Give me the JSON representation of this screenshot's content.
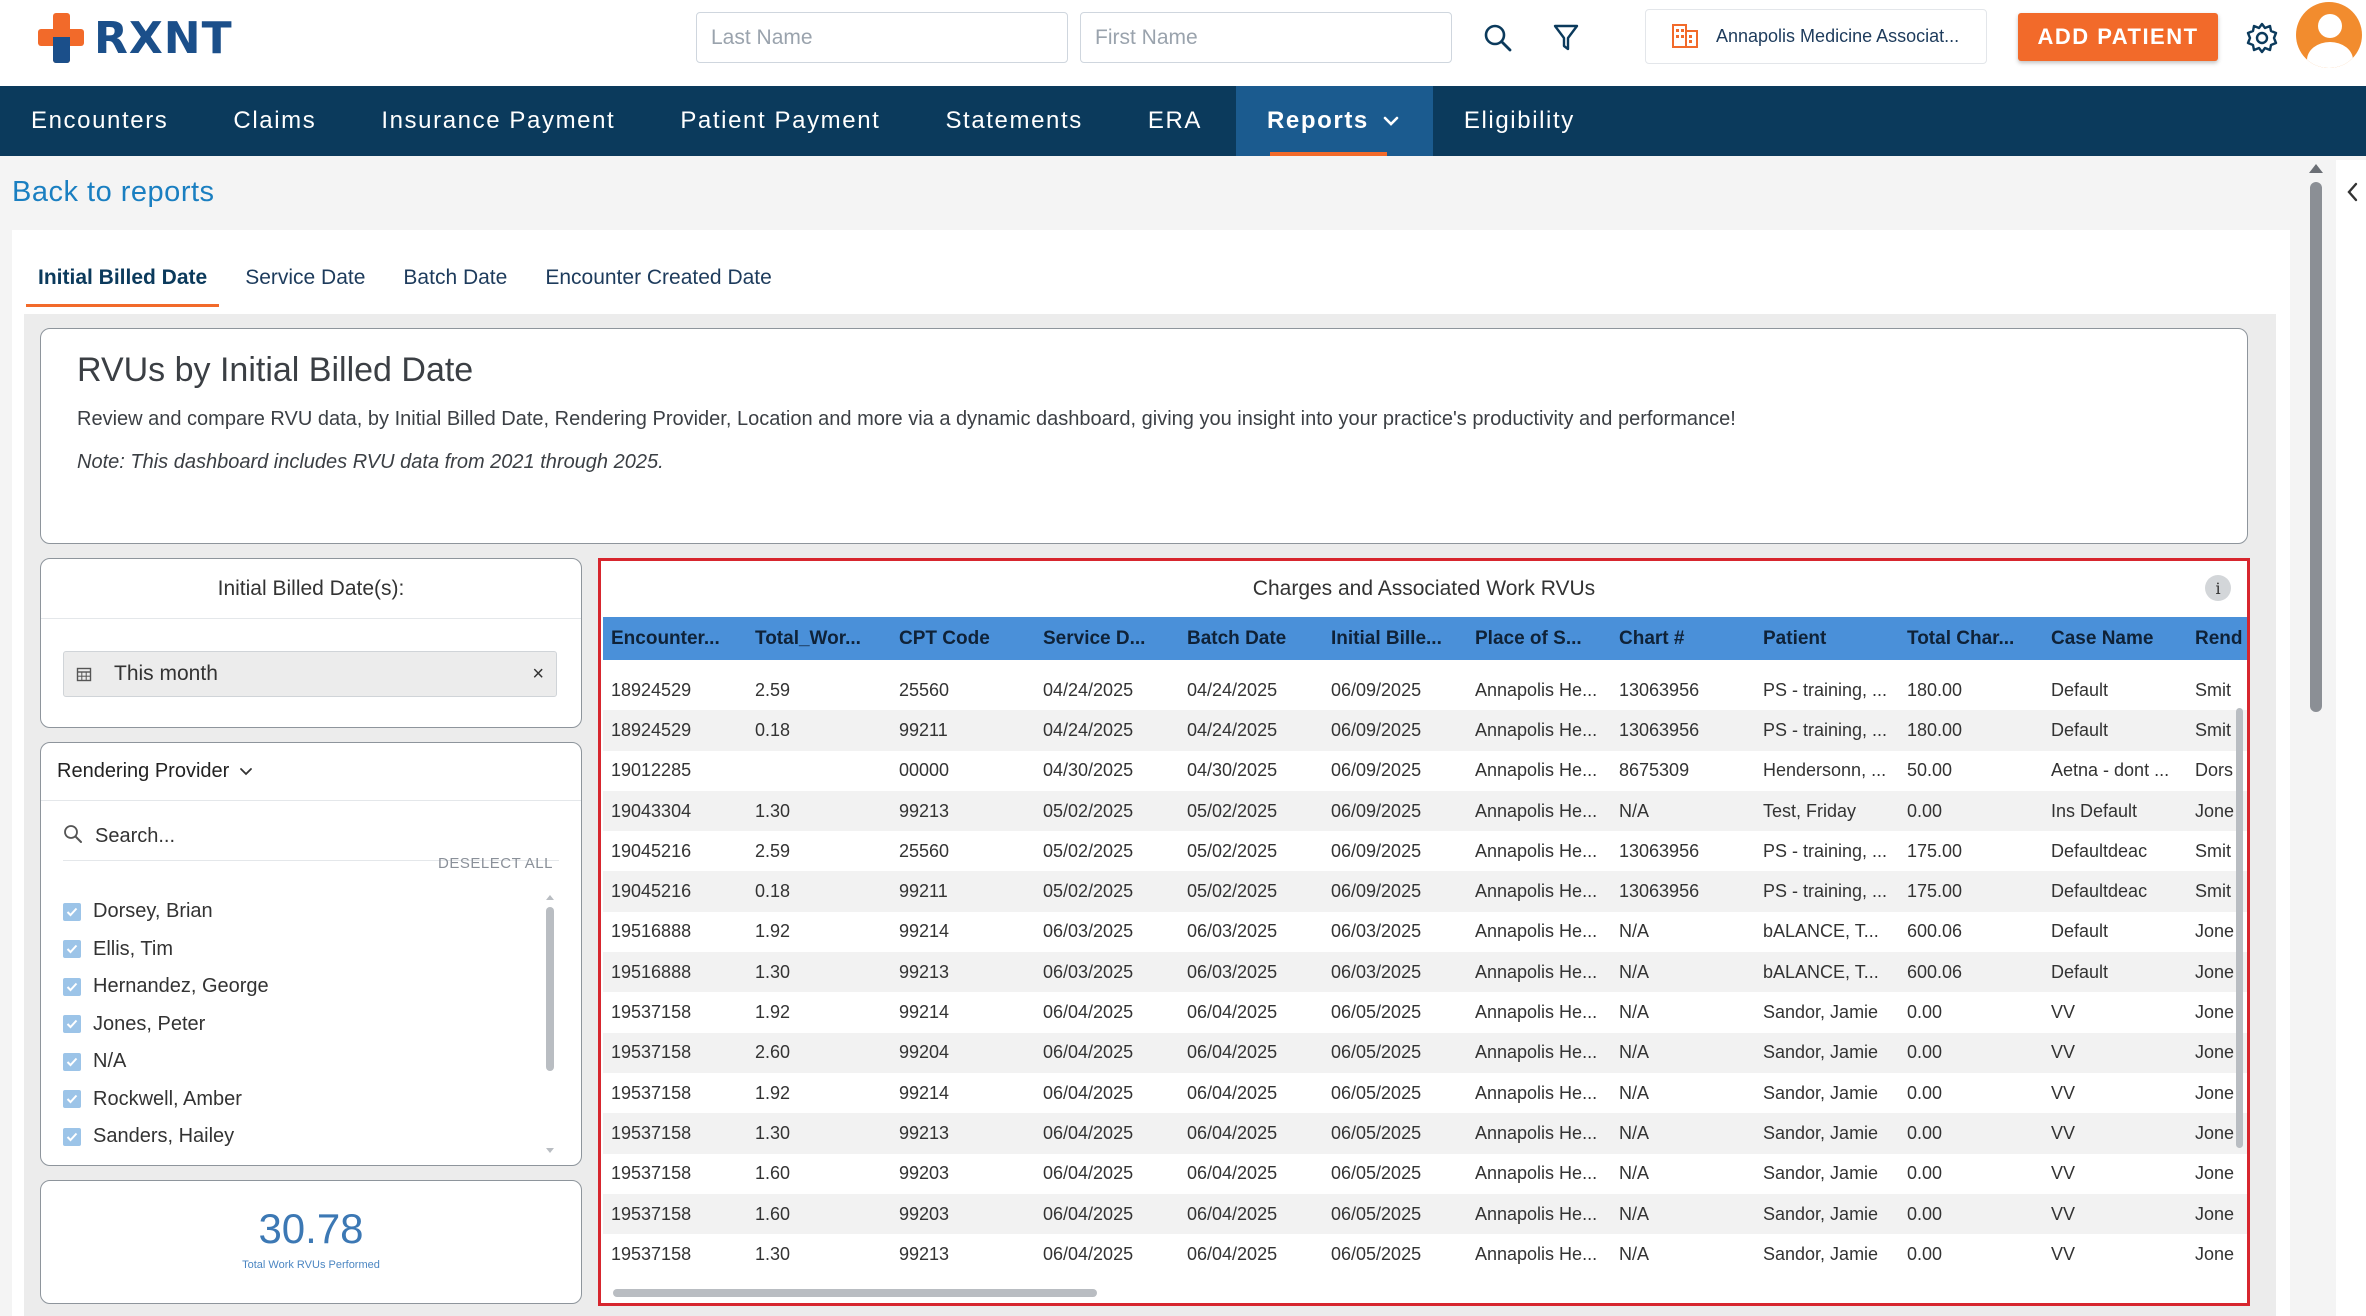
{
  "header": {
    "logo_text": "RXNT",
    "last_name_placeholder": "Last Name",
    "first_name_placeholder": "First Name",
    "icons": [
      "search-icon",
      "filter-icon",
      "building-icon",
      "gear-icon"
    ],
    "practice_name": "Annapolis Medicine Associat...",
    "add_patient_label": "ADD PATIENT",
    "colors": {
      "brand_orange": "#f26a2a",
      "brand_blue": "#1b4f8a",
      "nav_bg": "#0b3a5c"
    }
  },
  "nav": {
    "items": [
      "Encounters",
      "Claims",
      "Insurance Payment",
      "Patient Payment",
      "Statements",
      "ERA",
      "Reports",
      "Eligibility"
    ],
    "active": "Reports"
  },
  "page": {
    "back_link": "Back to reports",
    "tabs": [
      "Initial Billed Date",
      "Service Date",
      "Batch Date",
      "Encounter Created Date"
    ],
    "active_tab": "Initial Billed Date"
  },
  "info": {
    "title": "RVUs by Initial Billed Date",
    "description": "Review and compare RVU data, by Initial Billed Date, Rendering Provider, Location and more via a dynamic dashboard, giving you insight into your practice's productivity and performance!",
    "note": "Note: This dashboard includes RVU data from 2021 through 2025."
  },
  "filters": {
    "date_title": "Initial Billed Date(s):",
    "date_value": "This month",
    "clear_symbol": "×",
    "provider_title": "Rendering Provider",
    "provider_search_placeholder": "Search...",
    "deselect_all": "DESELECT ALL",
    "providers": [
      "Dorsey, Brian",
      "Ellis, Tim",
      "Hernandez, George",
      "Jones, Peter",
      "N/A",
      "Rockwell, Amber",
      "Sanders, Hailey"
    ]
  },
  "kpi": {
    "value": "30.78",
    "label": "Total Work RVUs Performed"
  },
  "table": {
    "title": "Charges and Associated Work RVUs",
    "info_symbol": "i",
    "columns": [
      "Encounter...",
      "Total_Wor...",
      "CPT Code",
      "Service D...",
      "Batch Date",
      "Initial Bille...",
      "Place of S...",
      "Chart #",
      "Patient",
      "Total Char...",
      "Case Name",
      "Rend"
    ],
    "rows": [
      [
        "18924529",
        "2.59",
        "25560",
        "04/24/2025",
        "04/24/2025",
        "06/09/2025",
        "Annapolis He...",
        "13063956",
        "PS - training, ...",
        "180.00",
        "Default",
        "Smit"
      ],
      [
        "18924529",
        "0.18",
        "99211",
        "04/24/2025",
        "04/24/2025",
        "06/09/2025",
        "Annapolis He...",
        "13063956",
        "PS - training, ...",
        "180.00",
        "Default",
        "Smit"
      ],
      [
        "19012285",
        "",
        "00000",
        "04/30/2025",
        "04/30/2025",
        "06/09/2025",
        "Annapolis He...",
        "8675309",
        "Hendersonn, ...",
        "50.00",
        "Aetna - dont ...",
        "Dors"
      ],
      [
        "19043304",
        "1.30",
        "99213",
        "05/02/2025",
        "05/02/2025",
        "06/09/2025",
        "Annapolis He...",
        "N/A",
        "Test, Friday",
        "0.00",
        "Ins Default",
        "Jone"
      ],
      [
        "19045216",
        "2.59",
        "25560",
        "05/02/2025",
        "05/02/2025",
        "06/09/2025",
        "Annapolis He...",
        "13063956",
        "PS - training, ...",
        "175.00",
        "Defaultdeac",
        "Smit"
      ],
      [
        "19045216",
        "0.18",
        "99211",
        "05/02/2025",
        "05/02/2025",
        "06/09/2025",
        "Annapolis He...",
        "13063956",
        "PS - training, ...",
        "175.00",
        "Defaultdeac",
        "Smit"
      ],
      [
        "19516888",
        "1.92",
        "99214",
        "06/03/2025",
        "06/03/2025",
        "06/03/2025",
        "Annapolis He...",
        "N/A",
        "bALANCE, T...",
        "600.06",
        "Default",
        "Jone"
      ],
      [
        "19516888",
        "1.30",
        "99213",
        "06/03/2025",
        "06/03/2025",
        "06/03/2025",
        "Annapolis He...",
        "N/A",
        "bALANCE, T...",
        "600.06",
        "Default",
        "Jone"
      ],
      [
        "19537158",
        "1.92",
        "99214",
        "06/04/2025",
        "06/04/2025",
        "06/05/2025",
        "Annapolis He...",
        "N/A",
        "Sandor, Jamie",
        "0.00",
        "VV",
        "Jone"
      ],
      [
        "19537158",
        "2.60",
        "99204",
        "06/04/2025",
        "06/04/2025",
        "06/05/2025",
        "Annapolis He...",
        "N/A",
        "Sandor, Jamie",
        "0.00",
        "VV",
        "Jone"
      ],
      [
        "19537158",
        "1.92",
        "99214",
        "06/04/2025",
        "06/04/2025",
        "06/05/2025",
        "Annapolis He...",
        "N/A",
        "Sandor, Jamie",
        "0.00",
        "VV",
        "Jone"
      ],
      [
        "19537158",
        "1.30",
        "99213",
        "06/04/2025",
        "06/04/2025",
        "06/05/2025",
        "Annapolis He...",
        "N/A",
        "Sandor, Jamie",
        "0.00",
        "VV",
        "Jone"
      ],
      [
        "19537158",
        "1.60",
        "99203",
        "06/04/2025",
        "06/04/2025",
        "06/05/2025",
        "Annapolis He...",
        "N/A",
        "Sandor, Jamie",
        "0.00",
        "VV",
        "Jone"
      ],
      [
        "19537158",
        "1.60",
        "99203",
        "06/04/2025",
        "06/04/2025",
        "06/05/2025",
        "Annapolis He...",
        "N/A",
        "Sandor, Jamie",
        "0.00",
        "VV",
        "Jone"
      ],
      [
        "19537158",
        "1.30",
        "99213",
        "06/04/2025",
        "06/04/2025",
        "06/05/2025",
        "Annapolis He...",
        "N/A",
        "Sandor, Jamie",
        "0.00",
        "VV",
        "Jone"
      ]
    ]
  }
}
